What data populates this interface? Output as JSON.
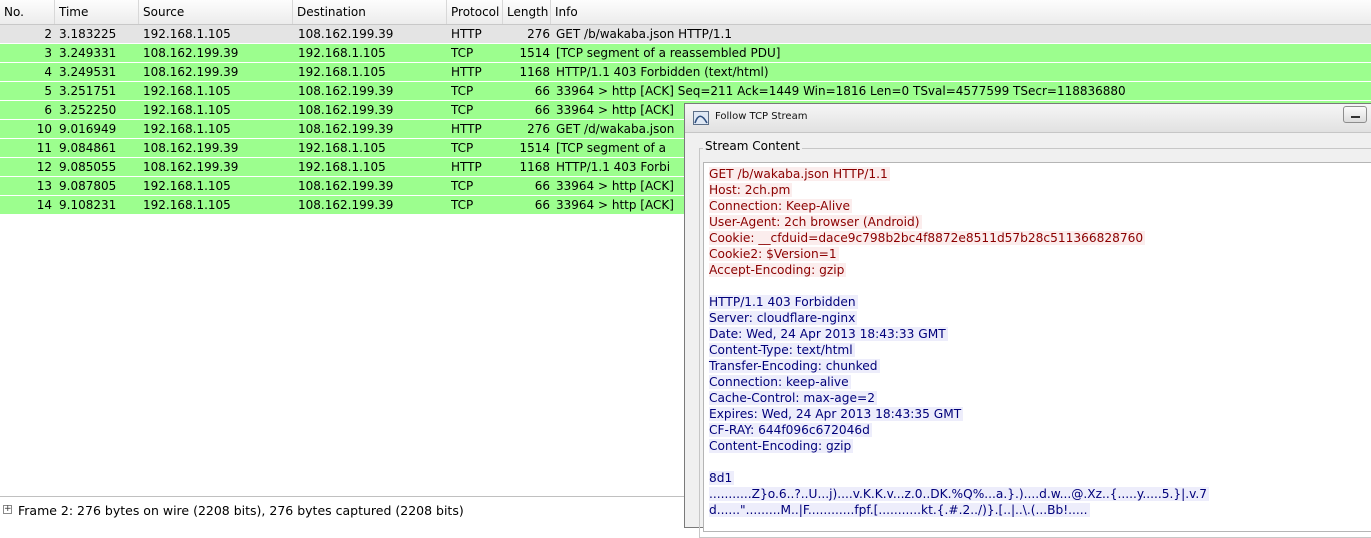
{
  "columns": {
    "no": "No.",
    "time": "Time",
    "source": "Source",
    "destination": "Destination",
    "protocol": "Protocol",
    "length": "Length",
    "info": "Info"
  },
  "packets": [
    {
      "no": "2",
      "time": "3.183225",
      "source": "192.168.1.105",
      "destination": "108.162.199.39",
      "protocol": "HTTP",
      "length": "276",
      "info": "GET /b/wakaba.json HTTP/1.1",
      "row_color": "#e4e4e4"
    },
    {
      "no": "3",
      "time": "3.249331",
      "source": "108.162.199.39",
      "destination": "192.168.1.105",
      "protocol": "TCP",
      "length": "1514",
      "info": "[TCP segment of a reassembled PDU]",
      "row_color": "#9cfe8e"
    },
    {
      "no": "4",
      "time": "3.249531",
      "source": "108.162.199.39",
      "destination": "192.168.1.105",
      "protocol": "HTTP",
      "length": "1168",
      "info": "HTTP/1.1 403 Forbidden  (text/html)",
      "row_color": "#9cfe8e"
    },
    {
      "no": "5",
      "time": "3.251751",
      "source": "192.168.1.105",
      "destination": "108.162.199.39",
      "protocol": "TCP",
      "length": "66",
      "info": "33964 > http [ACK] Seq=211 Ack=1449 Win=1816 Len=0 TSval=4577599 TSecr=118836880",
      "row_color": "#9cfe8e"
    },
    {
      "no": "6",
      "time": "3.252250",
      "source": "192.168.1.105",
      "destination": "108.162.199.39",
      "protocol": "TCP",
      "length": "66",
      "info": "33964 > http [ACK]",
      "row_color": "#9cfe8e"
    },
    {
      "no": "10",
      "time": "9.016949",
      "source": "192.168.1.105",
      "destination": "108.162.199.39",
      "protocol": "HTTP",
      "length": "276",
      "info": "GET /d/wakaba.json",
      "row_color": "#9cfe8e"
    },
    {
      "no": "11",
      "time": "9.084861",
      "source": "108.162.199.39",
      "destination": "192.168.1.105",
      "protocol": "TCP",
      "length": "1514",
      "info": "[TCP segment of a",
      "row_color": "#9cfe8e"
    },
    {
      "no": "12",
      "time": "9.085055",
      "source": "108.162.199.39",
      "destination": "192.168.1.105",
      "protocol": "HTTP",
      "length": "1168",
      "info": "HTTP/1.1 403 Forbi",
      "row_color": "#9cfe8e"
    },
    {
      "no": "13",
      "time": "9.087805",
      "source": "192.168.1.105",
      "destination": "108.162.199.39",
      "protocol": "TCP",
      "length": "66",
      "info": "33964 > http [ACK]",
      "row_color": "#9cfe8e"
    },
    {
      "no": "14",
      "time": "9.108231",
      "source": "192.168.1.105",
      "destination": "108.162.199.39",
      "protocol": "TCP",
      "length": "66",
      "info": "33964 > http [ACK]",
      "row_color": "#9cfe8e"
    }
  ],
  "detail": {
    "expander": "+",
    "frame_summary": "Frame 2: 276 bytes on wire (2208 bits), 276 bytes captured (2208 bits)"
  },
  "tcp_window": {
    "title": "Follow TCP Stream",
    "group_label": "Stream Content",
    "request_lines": [
      "GET /b/wakaba.json HTTP/1.1",
      "Host: 2ch.pm",
      "Connection: Keep-Alive",
      "User-Agent: 2ch browser (Android)",
      "Cookie: __cfduid=dace9c798b2bc4f8872e8511d57b28c511366828760",
      "Cookie2: $Version=1",
      "Accept-Encoding: gzip"
    ],
    "response_lines": [
      "HTTP/1.1 403 Forbidden",
      "Server: cloudflare-nginx",
      "Date: Wed, 24 Apr 2013 18:43:33 GMT",
      "Content-Type: text/html",
      "Transfer-Encoding: chunked",
      "Connection: keep-alive",
      "Cache-Control: max-age=2",
      "Expires: Wed, 24 Apr 2013 18:43:35 GMT",
      "CF-RAY: 644f096c672046d",
      "Content-Encoding: gzip"
    ],
    "body_lines": [
      "8d1",
      "...........Z}o.6..?..U...j)....v.K.K.v...z.0..DK.%Q%...a.}.)....d.w...@.Xz..{.....y.....5.}|.v.7",
      "d......\".........M..|F............fpf.[...........kt.{.#.2../)}.[..|..\\.(...Bb!....."
    ],
    "client_color": "#8b0000",
    "server_color": "#00007a"
  }
}
